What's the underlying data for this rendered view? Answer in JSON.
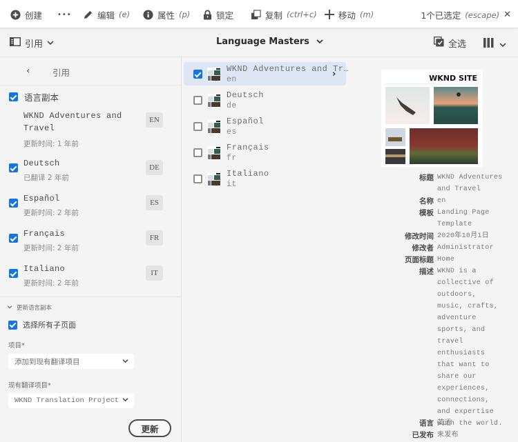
{
  "actionbar": {
    "create": "创建",
    "more": "•••",
    "edit": "编辑",
    "edit_hint": "(e)",
    "properties": "属性",
    "properties_hint": "(p)",
    "lock": "锁定",
    "copy": "复制",
    "copy_hint": "(ctrl+c)",
    "move": "移动",
    "move_hint": "(m)",
    "selection": "1个已选定",
    "selection_hint": "(escape)",
    "close": "✕"
  },
  "secondbar": {
    "rail_label": "引用",
    "breadcrumb": "Language Masters",
    "select_all": "全选"
  },
  "rail": {
    "header": "引用",
    "back": "‹",
    "language_copies_label": "语言副本",
    "copies": [
      {
        "name": "WKND Adventures and Travel",
        "meta": "更新时间: 1 年前",
        "badge": "EN",
        "checked": null
      },
      {
        "name": "Deutsch",
        "meta": "已翻译 2 年前",
        "badge": "DE",
        "checked": true
      },
      {
        "name": "Español",
        "meta": "更新时间: 2 年前",
        "badge": "ES",
        "checked": true
      },
      {
        "name": "Français",
        "meta": "更新时间: 2 年前",
        "badge": "FR",
        "checked": true
      },
      {
        "name": "Italiano",
        "meta": "更新时间: 2 年前",
        "badge": "IT",
        "checked": true
      }
    ],
    "update_section": "更新语言副本",
    "select_subpages": "选择所有子页面",
    "project_label": "项目*",
    "project_value": "添加到现有翻译项目",
    "existing_project_label": "现有翻译项目*",
    "existing_project_value": "WKND Translation Project",
    "update_button": "更新"
  },
  "list": {
    "rows": [
      {
        "title": "WKND Adventures and Tr…",
        "name": "en",
        "selected": true
      },
      {
        "title": "Deutsch",
        "name": "de",
        "selected": false
      },
      {
        "title": "Español",
        "name": "es",
        "selected": false
      },
      {
        "title": "Français",
        "name": "fr",
        "selected": false
      },
      {
        "title": "Italiano",
        "name": "it",
        "selected": false
      }
    ]
  },
  "details": {
    "preview_title": "WKND SITE",
    "fields": [
      {
        "key": "标题",
        "value": "WKND Adventures and Travel"
      },
      {
        "key": "名称",
        "value": "en"
      },
      {
        "key": "模板",
        "value": "Landing Page Template"
      },
      {
        "key": "修改时间",
        "value": "2020年10月1日"
      },
      {
        "key": "修改者",
        "value": "Administrator"
      },
      {
        "key": "页面标题",
        "value": "Home"
      },
      {
        "key": "描述",
        "value": "WKND is a collective of outdoors, music, crafts, adventure sports, and travel enthusiasts that want to share our experiences, connections, and expertise with the world."
      },
      {
        "key": "语言",
        "value": "英语"
      },
      {
        "key": "已发布",
        "value": "未发布"
      }
    ]
  },
  "colors": {
    "accent": "#1473e6",
    "selected_row": "#dde6f2",
    "background": "#f4f4f4"
  }
}
